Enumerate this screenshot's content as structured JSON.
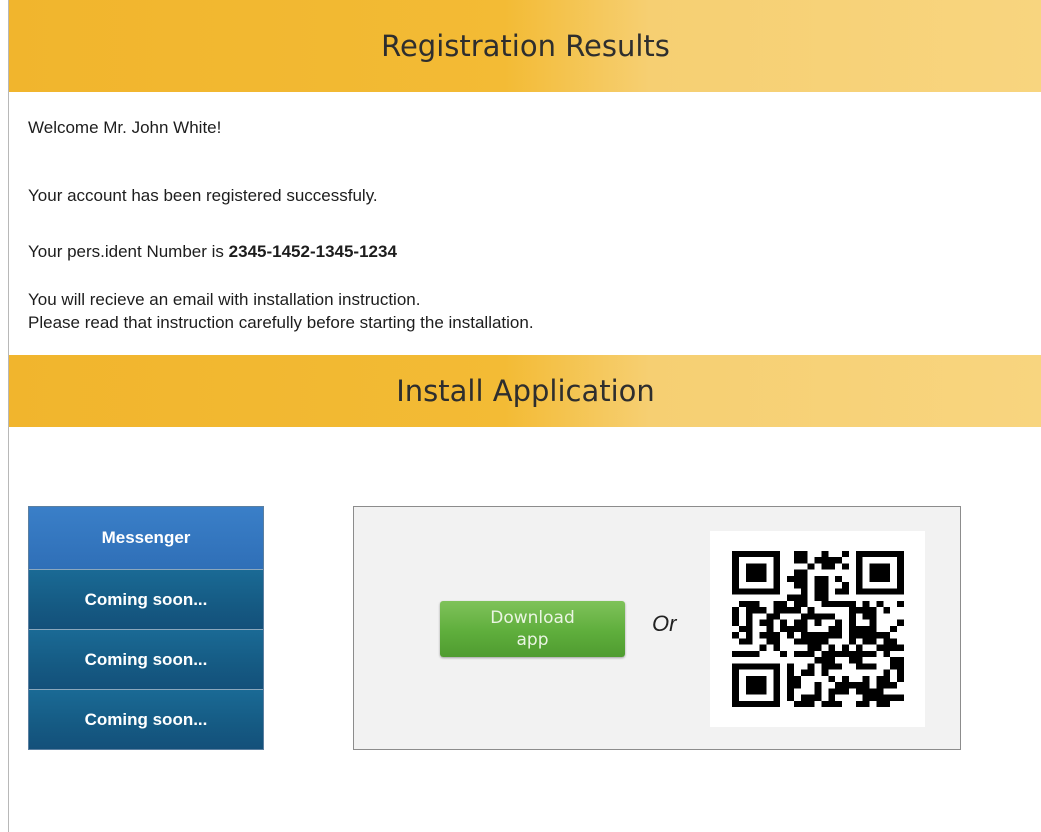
{
  "registration": {
    "heading": "Registration Results",
    "welcome": "Welcome Mr. John White!",
    "success": "Your account has been registered successfuly.",
    "ident_prefix": "Your pers.ident Number is",
    "ident_number": "2345-1452-1345-1234",
    "email_line1": "You will recieve an email with installation instruction.",
    "email_line2": "Please read that instruction carefully before starting the installation."
  },
  "install": {
    "heading": "Install Application",
    "menu": [
      {
        "label": "Messenger"
      },
      {
        "label": "Coming soon..."
      },
      {
        "label": "Coming soon..."
      },
      {
        "label": "Coming soon..."
      }
    ],
    "download_line1": "Download",
    "download_line2": "app",
    "or_label": "Or",
    "qr_icon": "qr-code"
  },
  "colors": {
    "banner": "#f1b52d",
    "menu_active": "#2f6fb7",
    "menu_item": "#155a83",
    "download_button": "#5fae3c"
  }
}
